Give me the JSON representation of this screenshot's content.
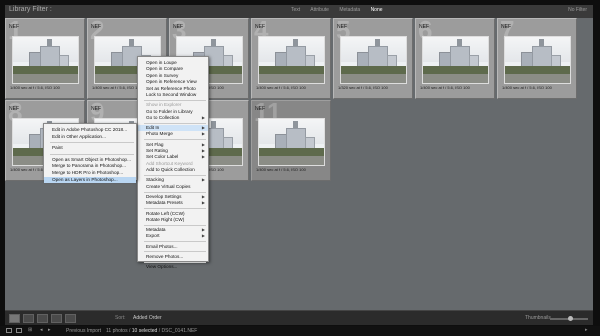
{
  "topbar": {
    "title": "Library Filter :",
    "filters": [
      {
        "label": "Text",
        "active": false
      },
      {
        "label": "Attribute",
        "active": false
      },
      {
        "label": "Metadata",
        "active": false
      },
      {
        "label": "None",
        "active": true
      }
    ],
    "preset": "No Filter"
  },
  "grid": {
    "cells": [
      {
        "num": "1",
        "format": "NEF",
        "meta": "1/400 sec at f / 5.6, ISO 100",
        "selected": true
      },
      {
        "num": "2",
        "format": "NEF",
        "meta": "1/400 sec at f / 5.6, ISO 100",
        "selected": true
      },
      {
        "num": "3",
        "format": "NEF",
        "meta": "1/400 sec at f / 5.6, ISO 100",
        "selected": true
      },
      {
        "num": "4",
        "format": "NEF",
        "meta": "1/400 sec at f / 5.6, ISO 100",
        "selected": true
      },
      {
        "num": "5",
        "format": "NEF",
        "meta": "1/320 sec at f / 5.6, ISO 100",
        "selected": true
      },
      {
        "num": "6",
        "format": "NEF",
        "meta": "1/400 sec at f / 5.6, ISO 100",
        "selected": true
      },
      {
        "num": "7",
        "format": "NEF",
        "meta": "1/400 sec at f / 5.6, ISO 100",
        "selected": true
      },
      {
        "num": "8",
        "format": "NEF",
        "meta": "1/400 sec at f / 5.6, ISO 100",
        "selected": true
      },
      {
        "num": "9",
        "format": "NEF",
        "meta": "1/400 sec at f / 5.6, ISO 100",
        "selected": true
      },
      {
        "num": "10",
        "format": "NEF",
        "meta": "1/400 sec at f / 5.6, ISO 100",
        "selected": true
      },
      {
        "num": "11",
        "format": "NEF",
        "meta": "1/400 sec at f / 5.6, ISO 100",
        "selected": false
      }
    ]
  },
  "context_menu": {
    "groups": [
      [
        {
          "label": "Open in Loupe",
          "arrow": false,
          "disabled": false
        },
        {
          "label": "Open in Compare",
          "arrow": false,
          "disabled": false
        },
        {
          "label": "Open in Survey",
          "arrow": false,
          "disabled": false
        },
        {
          "label": "Open in Reference View",
          "arrow": false,
          "disabled": false
        },
        {
          "label": "Set as Reference Photo",
          "arrow": false,
          "disabled": false
        },
        {
          "label": "Lock to Second Window",
          "arrow": false,
          "disabled": false
        }
      ],
      [
        {
          "label": "Show in Explorer",
          "arrow": false,
          "disabled": true
        },
        {
          "label": "Go to Folder in Library",
          "arrow": false,
          "disabled": false
        },
        {
          "label": "Go to Collection",
          "arrow": true,
          "disabled": false
        }
      ],
      [
        {
          "label": "Edit In",
          "arrow": true,
          "disabled": false,
          "highlight": true
        },
        {
          "label": "Photo Merge",
          "arrow": true,
          "disabled": false
        }
      ],
      [
        {
          "label": "Set Flag",
          "arrow": true,
          "disabled": false
        },
        {
          "label": "Set Rating",
          "arrow": true,
          "disabled": false
        },
        {
          "label": "Set Color Label",
          "arrow": true,
          "disabled": false
        },
        {
          "label": "Add Shortcut Keyword",
          "arrow": false,
          "disabled": true
        },
        {
          "label": "Add to Quick Collection",
          "arrow": false,
          "disabled": false
        }
      ],
      [
        {
          "label": "Stacking",
          "arrow": true,
          "disabled": false
        },
        {
          "label": "Create Virtual Copies",
          "arrow": false,
          "disabled": false
        }
      ],
      [
        {
          "label": "Develop Settings",
          "arrow": true,
          "disabled": false
        },
        {
          "label": "Metadata Presets",
          "arrow": true,
          "disabled": false
        }
      ],
      [
        {
          "label": "Rotate Left (CCW)",
          "arrow": false,
          "disabled": false
        },
        {
          "label": "Rotate Right (CW)",
          "arrow": false,
          "disabled": false
        }
      ],
      [
        {
          "label": "Metadata",
          "arrow": true,
          "disabled": false
        },
        {
          "label": "Export",
          "arrow": true,
          "disabled": false
        }
      ],
      [
        {
          "label": "Email Photos...",
          "arrow": false,
          "disabled": false
        }
      ],
      [
        {
          "label": "Remove Photos...",
          "arrow": false,
          "disabled": false
        }
      ],
      [
        {
          "label": "View Options...",
          "arrow": false,
          "disabled": false
        }
      ]
    ]
  },
  "submenu": {
    "groups": [
      [
        {
          "label": "Edit in Adobe Photoshop CC 2018..."
        },
        {
          "label": "Edit in Other Application..."
        }
      ],
      [
        {
          "label": "Paint"
        }
      ],
      [
        {
          "label": "Open as Smart Object in Photoshop..."
        },
        {
          "label": "Merge to Panorama in Photoshop..."
        },
        {
          "label": "Merge to HDR Pro in Photoshop..."
        },
        {
          "label": "Open as Layers in Photoshop...",
          "highlight": true
        }
      ]
    ]
  },
  "toolbar": {
    "sort_label": "Sort:",
    "sort_value": "Added Order",
    "thumbnails_label": "Thumbnails",
    "thumbnail_size": 0.55
  },
  "filmstrip": {
    "source": "Previous Import",
    "count_prefix": "11 photos / ",
    "count_selected": "10 selected",
    "count_suffix": " / DSC_0141.NEF"
  }
}
